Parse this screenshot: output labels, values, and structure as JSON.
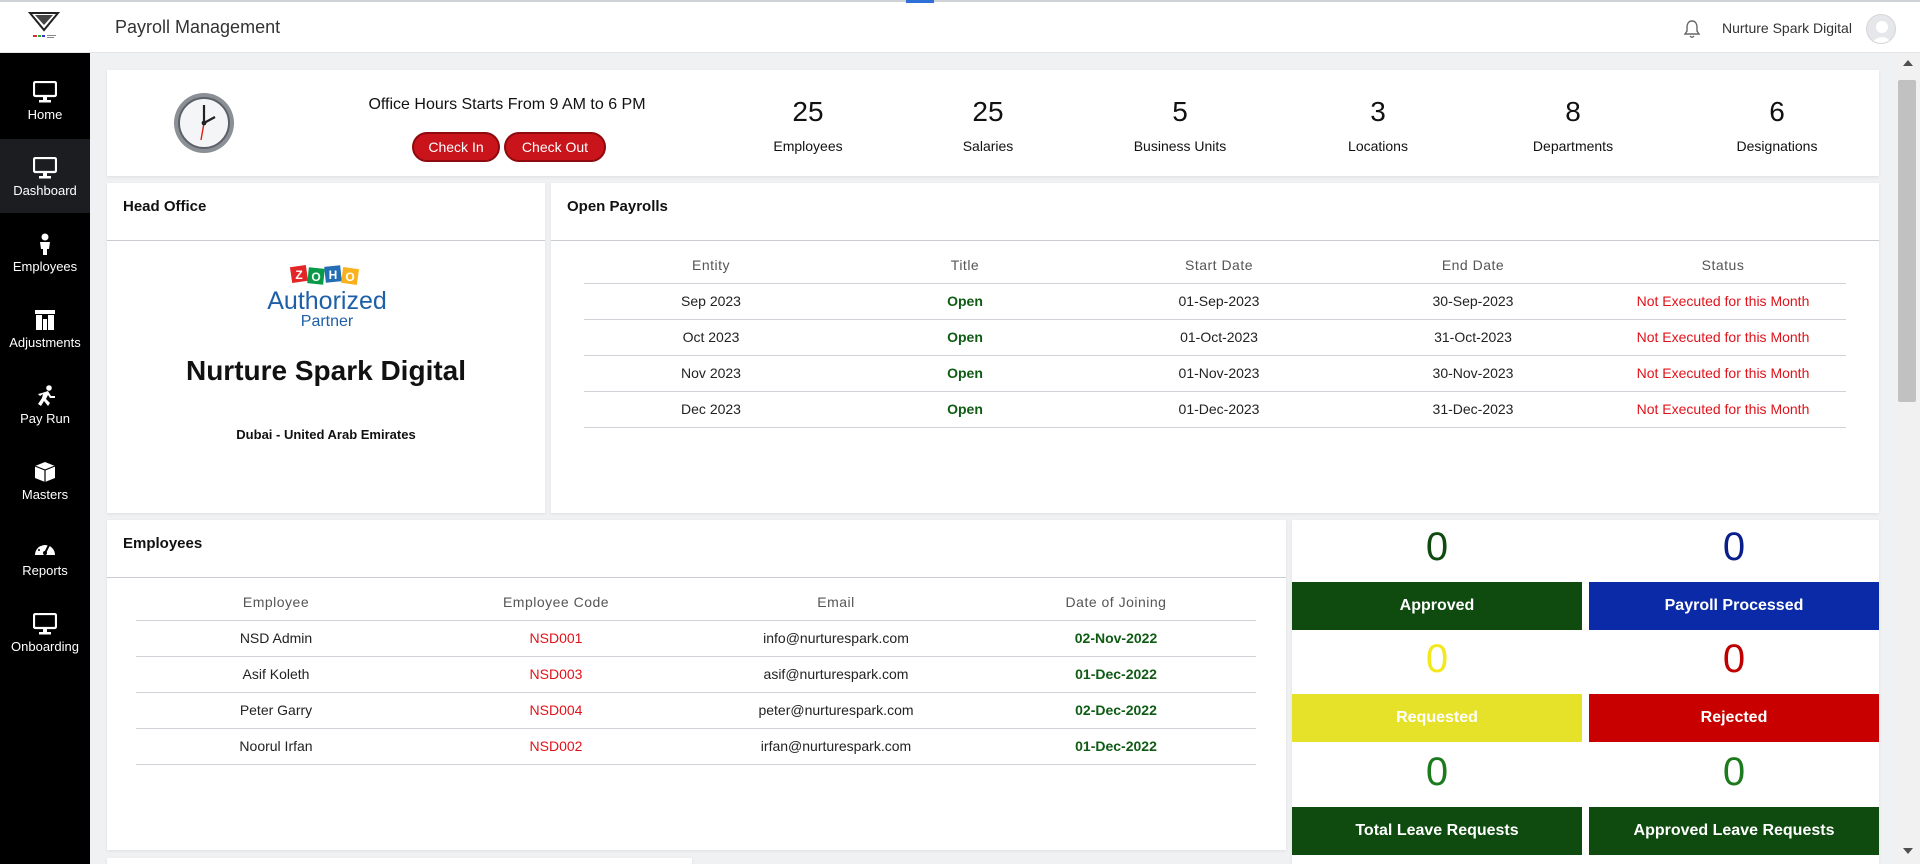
{
  "header": {
    "title": "Payroll Management",
    "user_name": "Nurture Spark Digital"
  },
  "sidebar": {
    "items": [
      {
        "label": "Home",
        "icon": "monitor-icon"
      },
      {
        "label": "Dashboard",
        "icon": "monitor-icon"
      },
      {
        "label": "Employees",
        "icon": "person-icon"
      },
      {
        "label": "Adjustments",
        "icon": "columns-icon"
      },
      {
        "label": "Pay Run",
        "icon": "running-icon"
      },
      {
        "label": "Masters",
        "icon": "box-icon"
      },
      {
        "label": "Reports",
        "icon": "gauge-icon"
      },
      {
        "label": "Onboarding",
        "icon": "monitor-icon"
      }
    ],
    "active": "Dashboard"
  },
  "summary": {
    "office_hours": "Office Hours Starts From 9 AM to 6 PM",
    "check_in": "Check In",
    "check_out": "Check Out",
    "stats": [
      {
        "value": "25",
        "label": "Employees"
      },
      {
        "value": "25",
        "label": "Salaries"
      },
      {
        "value": "5",
        "label": "Business Units"
      },
      {
        "value": "3",
        "label": "Locations"
      },
      {
        "value": "8",
        "label": "Departments"
      },
      {
        "value": "6",
        "label": "Designations"
      }
    ]
  },
  "head_office": {
    "title": "Head Office",
    "logo_brand": "ZOHO",
    "logo_line1": "Authorized",
    "logo_line2": "Partner",
    "company_name": "Nurture Spark Digital",
    "location": "Dubai - United Arab Emirates"
  },
  "open_payrolls": {
    "title": "Open Payrolls",
    "columns": [
      "Entity",
      "Title",
      "Start Date",
      "End Date",
      "Status"
    ],
    "rows": [
      [
        "Sep 2023",
        "Open",
        "01-Sep-2023",
        "30-Sep-2023",
        "Not Executed for this Month"
      ],
      [
        "Oct 2023",
        "Open",
        "01-Oct-2023",
        "31-Oct-2023",
        "Not Executed for this Month"
      ],
      [
        "Nov 2023",
        "Open",
        "01-Nov-2023",
        "30-Nov-2023",
        "Not Executed for this Month"
      ],
      [
        "Dec 2023",
        "Open",
        "01-Dec-2023",
        "31-Dec-2023",
        "Not Executed for this Month"
      ]
    ]
  },
  "employees": {
    "title": "Employees",
    "columns": [
      "Employee",
      "Employee Code",
      "Email",
      "Date of Joining"
    ],
    "rows": [
      [
        "NSD Admin",
        "NSD001",
        "info@nurturespark.com",
        "02-Nov-2022"
      ],
      [
        "Asif Koleth",
        "NSD003",
        "asif@nurturespark.com",
        "01-Dec-2022"
      ],
      [
        "Peter Garry",
        "NSD004",
        "peter@nurturespark.com",
        "02-Dec-2022"
      ],
      [
        "Noorul Irfan",
        "NSD002",
        "irfan@nurturespark.com",
        "01-Dec-2022"
      ]
    ]
  },
  "status_tiles": [
    {
      "value": "0",
      "label": "Approved",
      "num_color": "#0f4a0f",
      "bg": "#0f4a0f"
    },
    {
      "value": "0",
      "label": "Payroll Processed",
      "num_color": "#0a1f8a",
      "bg": "#0a2aa8"
    },
    {
      "value": "0",
      "label": "Requested",
      "num_color": "#f2e81c",
      "bg": "#e6e22a"
    },
    {
      "value": "0",
      "label": "Rejected",
      "num_color": "#c00000",
      "bg": "#c80000"
    },
    {
      "value": "0",
      "label": "Total Leave Requests",
      "num_color": "#1e7a1e",
      "bg": "#0f4a0f"
    },
    {
      "value": "0",
      "label": "Approved Leave Requests",
      "num_color": "#1e7a1e",
      "bg": "#0f4a0f"
    }
  ],
  "colors": {
    "sidebar_bg": "#000000",
    "accent_red": "#c8141a",
    "status_red": "#e0121a",
    "status_green": "#0f5b14"
  }
}
